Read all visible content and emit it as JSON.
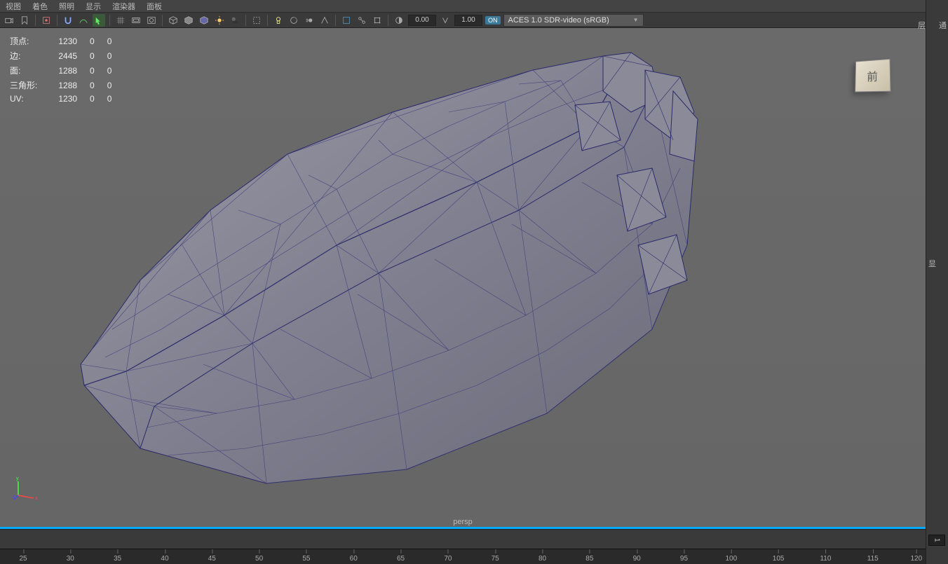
{
  "menu": {
    "items": [
      "视图",
      "着色",
      "照明",
      "显示",
      "渲染器",
      "面板"
    ]
  },
  "toolbar": {
    "rotate_val": "0.00",
    "scale_val": "1.00",
    "colorspace_on": "ON",
    "colorspace": "ACES 1.0 SDR-video (sRGB)"
  },
  "stats": {
    "rows": [
      {
        "label": "顶点:",
        "c1": "1230",
        "c2": "0",
        "c3": "0"
      },
      {
        "label": "边:",
        "c1": "2445",
        "c2": "0",
        "c3": "0"
      },
      {
        "label": "面:",
        "c1": "1288",
        "c2": "0",
        "c3": "0"
      },
      {
        "label": "三角形:",
        "c1": "1288",
        "c2": "0",
        "c3": "0"
      },
      {
        "label": "UV:",
        "c1": "1230",
        "c2": "0",
        "c3": "0"
      }
    ]
  },
  "viewcube": {
    "face": "前"
  },
  "viewport": {
    "camera": "persp"
  },
  "timeline": {
    "ticks": [
      "25",
      "30",
      "35",
      "40",
      "45",
      "50",
      "55",
      "60",
      "65",
      "70",
      "75",
      "80",
      "85",
      "90",
      "95",
      "100",
      "105",
      "110",
      "115",
      "120"
    ],
    "current_frame": "1"
  },
  "right_panel": {
    "top": "通",
    "mid1": "显",
    "mid2": "层"
  },
  "icons": {
    "camera": "camera-icon",
    "select": "select-icon"
  }
}
